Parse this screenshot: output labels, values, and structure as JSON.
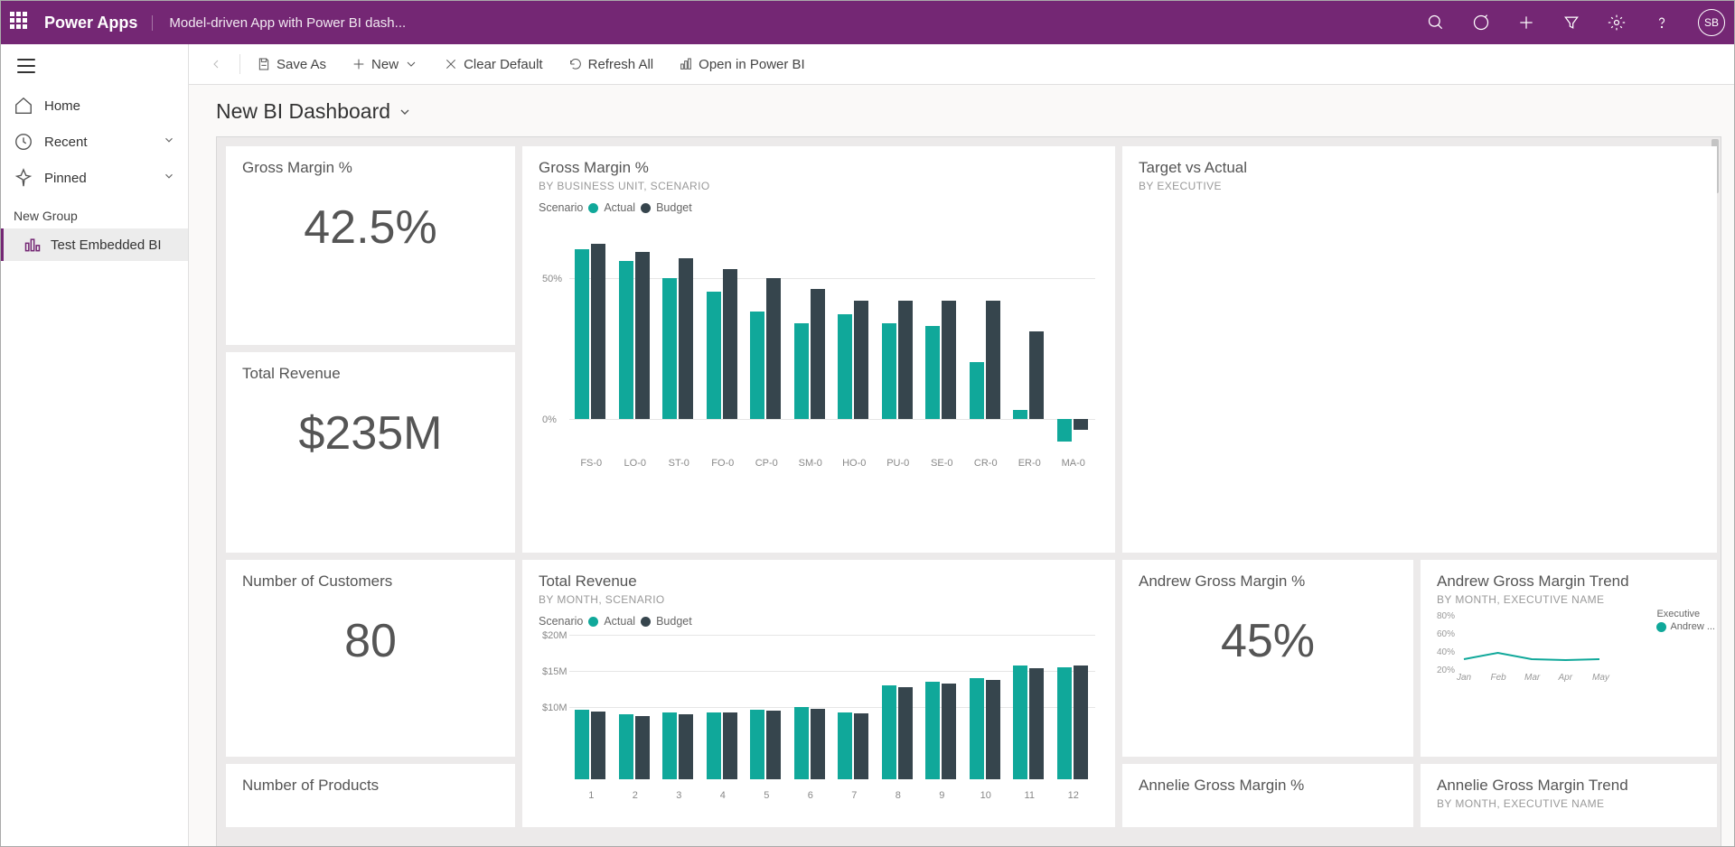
{
  "header": {
    "brand": "Power Apps",
    "subtitle": "Model-driven App with Power BI dash...",
    "avatar": "SB"
  },
  "sidebar": {
    "home": "Home",
    "recent": "Recent",
    "pinned": "Pinned",
    "section": "New Group",
    "selected": "Test Embedded BI"
  },
  "cmdbar": {
    "save_as": "Save As",
    "new": "New",
    "clear_default": "Clear Default",
    "refresh_all": "Refresh All",
    "open_pbi": "Open in Power BI"
  },
  "page_title": "New BI Dashboard",
  "tiles": {
    "gm_pct": {
      "title": "Gross Margin %",
      "value": "42.5%"
    },
    "total_rev": {
      "title": "Total Revenue",
      "value": "$235M"
    },
    "num_cust": {
      "title": "Number of Customers",
      "value": "80"
    },
    "num_prod": {
      "title": "Number of Products"
    },
    "gm_bar": {
      "title": "Gross Margin %",
      "subtitle": "BY BUSINESS UNIT, SCENARIO",
      "legend_title": "Scenario",
      "legend_a": "Actual",
      "legend_b": "Budget"
    },
    "tva": {
      "title": "Target vs Actual",
      "subtitle": "BY EXECUTIVE"
    },
    "rev_bar": {
      "title": "Total Revenue",
      "subtitle": "BY MONTH, SCENARIO",
      "legend_title": "Scenario",
      "legend_a": "Actual",
      "legend_b": "Budget"
    },
    "andrew_gm": {
      "title": "Andrew Gross Margin %",
      "value": "45%"
    },
    "andrew_trend": {
      "title": "Andrew Gross Margin Trend",
      "subtitle": "BY MONTH, EXECUTIVE NAME",
      "legend_title": "Executive",
      "legend_item": "Andrew ..."
    },
    "annelie_gm": {
      "title": "Annelie Gross Margin %"
    },
    "annelie_trend": {
      "title": "Annelie Gross Margin Trend",
      "subtitle": "BY MONTH, EXECUTIVE NAME"
    }
  },
  "chart_data": [
    {
      "id": "gm_by_bu",
      "type": "bar",
      "title": "Gross Margin % by Business Unit, Scenario",
      "ylabel": "%",
      "ylim": [
        -10,
        70
      ],
      "ticks": [
        0,
        50
      ],
      "categories": [
        "FS-0",
        "LO-0",
        "ST-0",
        "FO-0",
        "CP-0",
        "SM-0",
        "HO-0",
        "PU-0",
        "SE-0",
        "CR-0",
        "ER-0",
        "MA-0"
      ],
      "series": [
        {
          "name": "Actual",
          "color": "#10a89a",
          "values": [
            60,
            56,
            50,
            45,
            38,
            34,
            37,
            34,
            33,
            20,
            3,
            -8
          ]
        },
        {
          "name": "Budget",
          "color": "#36454d",
          "values": [
            62,
            59,
            57,
            53,
            50,
            46,
            42,
            42,
            42,
            42,
            31,
            -4
          ]
        }
      ]
    },
    {
      "id": "rev_by_month",
      "type": "bar",
      "title": "Total Revenue by Month, Scenario",
      "ylabel": "$M",
      "ylim": [
        0,
        20
      ],
      "ticks": [
        10,
        15,
        20
      ],
      "categories": [
        "1",
        "2",
        "3",
        "4",
        "5",
        "6",
        "7",
        "8",
        "9",
        "10",
        "11",
        "12"
      ],
      "series": [
        {
          "name": "Actual",
          "color": "#10a89a",
          "values": [
            9.6,
            9.0,
            9.2,
            9.3,
            9.6,
            10.0,
            9.3,
            13.0,
            13.5,
            14.0,
            15.7,
            15.5
          ]
        },
        {
          "name": "Budget",
          "color": "#36454d",
          "values": [
            9.4,
            8.8,
            9.0,
            9.2,
            9.5,
            9.8,
            9.1,
            12.8,
            13.2,
            13.8,
            15.4,
            15.8
          ]
        }
      ]
    },
    {
      "id": "andrew_trend",
      "type": "line",
      "title": "Andrew Gross Margin Trend",
      "xlabel": "Month",
      "ylabel": "%",
      "ylim": [
        20,
        80
      ],
      "ticks": [
        20,
        40,
        60,
        80
      ],
      "categories": [
        "Jan",
        "Feb",
        "Mar",
        "Apr",
        "May"
      ],
      "series": [
        {
          "name": "Andrew",
          "color": "#10a89a",
          "values": [
            33,
            40,
            33,
            32,
            33
          ]
        }
      ]
    }
  ]
}
